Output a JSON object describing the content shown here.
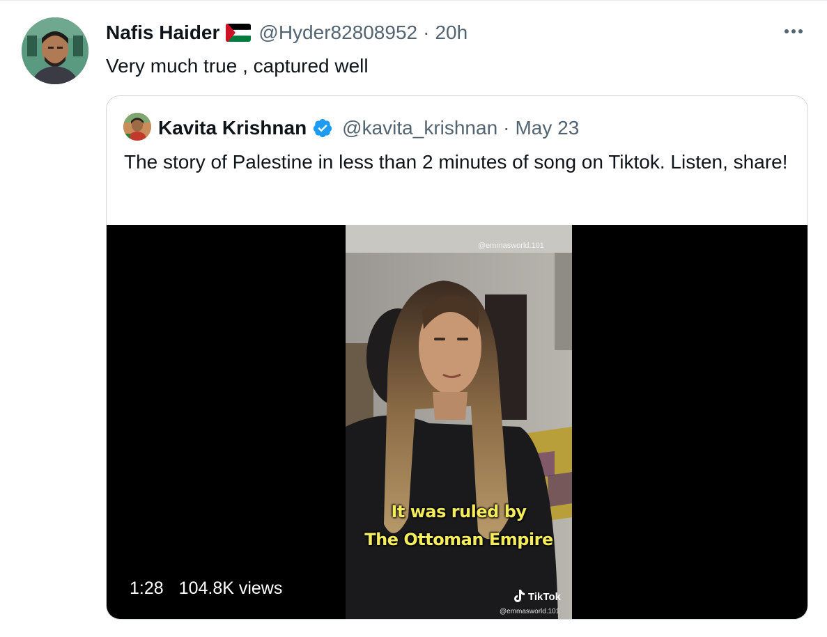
{
  "tweet": {
    "author": {
      "display_name": "Nafis Haider",
      "flag_icon": "palestine-flag",
      "handle": "@Hyder82808952"
    },
    "separator": "·",
    "timestamp": "20h",
    "text": "Very much true , captured well",
    "more_icon": "more-horizontal-icon"
  },
  "quoted_tweet": {
    "author": {
      "display_name": "Kavita Krishnan",
      "verified_icon": "verified-badge-icon",
      "handle": "@kavita_krishnan"
    },
    "separator": "·",
    "date": "May 23",
    "text": "The story of Palestine in less than 2 minutes of song on Tiktok. Listen, share!",
    "media": {
      "type": "video",
      "duration": "1:28",
      "views": "104.8K views",
      "watermark_top": "@emmasworld.101",
      "caption_line1": "It was ruled by",
      "caption_line2": "The Ottoman Empire",
      "tiktok_label": "TikTok",
      "tiktok_handle": "@emmasworld.101"
    }
  },
  "colors": {
    "text_primary": "#0f1419",
    "text_secondary": "#536471",
    "border": "#cfd9de",
    "verified_blue": "#1d9bf0",
    "caption_yellow": "#f4ec5a"
  }
}
